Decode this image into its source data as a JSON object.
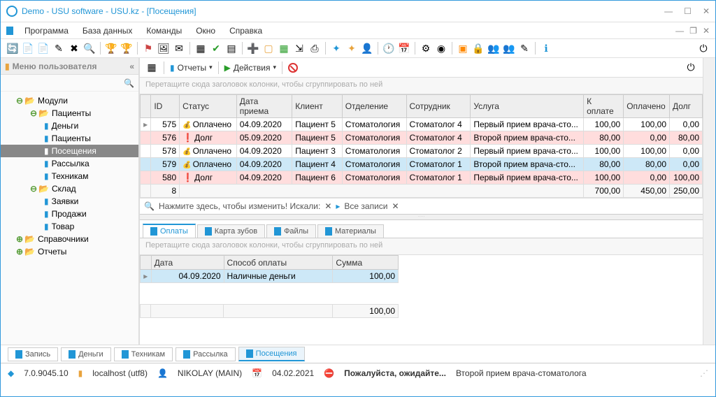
{
  "title": "Demo - USU software - USU.kz - [Посещения]",
  "menu": [
    "Программа",
    "База данных",
    "Команды",
    "Окно",
    "Справка"
  ],
  "sidebar": {
    "header": "Меню пользователя",
    "items": [
      {
        "label": "Модули",
        "kind": "folder",
        "exp": "⊖",
        "lvl": 1
      },
      {
        "label": "Пациенты",
        "kind": "folder",
        "exp": "⊖",
        "lvl": 2
      },
      {
        "label": "Деньги",
        "kind": "doc",
        "lvl": 3
      },
      {
        "label": "Пациенты",
        "kind": "doc",
        "lvl": 3
      },
      {
        "label": "Посещения",
        "kind": "doc",
        "lvl": 3,
        "selected": true
      },
      {
        "label": "Рассылка",
        "kind": "doc",
        "lvl": 3
      },
      {
        "label": "Техникам",
        "kind": "doc",
        "lvl": 3
      },
      {
        "label": "Склад",
        "kind": "folder",
        "exp": "⊖",
        "lvl": 2
      },
      {
        "label": "Заявки",
        "kind": "doc",
        "lvl": 3
      },
      {
        "label": "Продажи",
        "kind": "doc",
        "lvl": 3
      },
      {
        "label": "Товар",
        "kind": "doc",
        "lvl": 3
      },
      {
        "label": "Справочники",
        "kind": "folder",
        "exp": "⊕",
        "lvl": 1
      },
      {
        "label": "Отчеты",
        "kind": "folder",
        "exp": "⊕",
        "lvl": 1
      }
    ]
  },
  "toolbar2": {
    "reports": "Отчеты",
    "actions": "Действия"
  },
  "grouphint": "Перетащите сюда заголовок колонки, чтобы сгруппировать по ней",
  "grid": {
    "columns": [
      "ID",
      "Статус",
      "Дата приема",
      "Клиент",
      "Отделение",
      "Сотрудник",
      "Услуга",
      "К оплате",
      "Оплачено",
      "Долг"
    ],
    "rows": [
      {
        "id": "575",
        "status": "Оплачено",
        "paid": true,
        "date": "04.09.2020",
        "client": "Пациент 5",
        "dept": "Стоматология",
        "emp": "Стоматолог 4",
        "srv": "Первый прием врача-сто...",
        "due": "100,00",
        "pd": "100,00",
        "debt": "0,00"
      },
      {
        "id": "576",
        "status": "Долг",
        "paid": false,
        "date": "05.09.2020",
        "client": "Пациент 5",
        "dept": "Стоматология",
        "emp": "Стоматолог 4",
        "srv": "Второй прием врача-сто...",
        "due": "80,00",
        "pd": "0,00",
        "debt": "80,00",
        "isdebt": true
      },
      {
        "id": "578",
        "status": "Оплачено",
        "paid": true,
        "date": "04.09.2020",
        "client": "Пациент 3",
        "dept": "Стоматология",
        "emp": "Стоматолог 2",
        "srv": "Первый прием врача-сто...",
        "due": "100,00",
        "pd": "100,00",
        "debt": "0,00"
      },
      {
        "id": "579",
        "status": "Оплачено",
        "paid": true,
        "date": "04.09.2020",
        "client": "Пациент 4",
        "dept": "Стоматология",
        "emp": "Стоматолог 1",
        "srv": "Второй прием врача-сто...",
        "due": "80,00",
        "pd": "80,00",
        "debt": "0,00",
        "selected": true
      },
      {
        "id": "580",
        "status": "Долг",
        "paid": false,
        "date": "04.09.2020",
        "client": "Пациент 6",
        "dept": "Стоматология",
        "emp": "Стоматолог 1",
        "srv": "Первый прием врача-сто...",
        "due": "100,00",
        "pd": "0,00",
        "debt": "100,00",
        "isdebt": true
      }
    ],
    "footer": {
      "count": "8",
      "due": "700,00",
      "pd": "450,00",
      "debt": "250,00"
    }
  },
  "searchbar": {
    "hint": "Нажмите здесь, чтобы изменить! Искали:",
    "all": "Все записи"
  },
  "detail_tabs": [
    "Оплаты",
    "Карта зубов",
    "Файлы",
    "Материалы"
  ],
  "detail": {
    "columns": [
      "Дата",
      "Способ оплаты",
      "Сумма"
    ],
    "rows": [
      {
        "date": "04.09.2020",
        "method": "Наличные деньги",
        "sum": "100,00"
      }
    ],
    "footer_sum": "100,00"
  },
  "bottom_tabs": [
    "Запись",
    "Деньги",
    "Техникам",
    "Рассылка",
    "Посещения"
  ],
  "status": {
    "version": "7.0.9045.10",
    "host": "localhost (utf8)",
    "user": "NIKOLAY (MAIN)",
    "date": "04.02.2021",
    "wait": "Пожалуйста, ожидайте...",
    "info": "Второй прием врача-стоматолога"
  }
}
